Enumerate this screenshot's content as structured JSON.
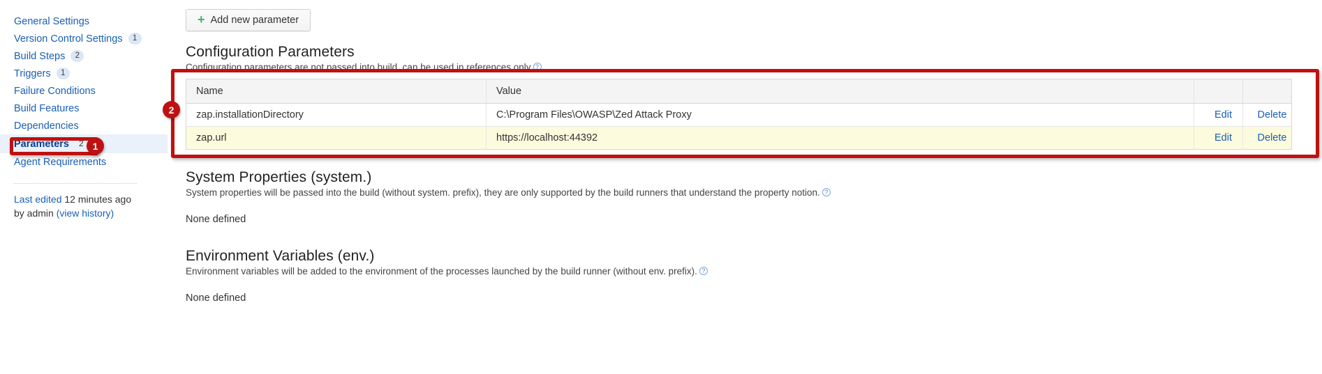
{
  "sidebar": {
    "items": [
      {
        "label": "General Settings",
        "badge": "",
        "selected": false
      },
      {
        "label": "Version Control Settings",
        "badge": "1",
        "selected": false
      },
      {
        "label": "Build Steps",
        "badge": "2",
        "selected": false
      },
      {
        "label": "Triggers",
        "badge": "1",
        "selected": false
      },
      {
        "label": "Failure Conditions",
        "badge": "",
        "selected": false
      },
      {
        "label": "Build Features",
        "badge": "",
        "selected": false
      },
      {
        "label": "Dependencies",
        "badge": "",
        "selected": false
      },
      {
        "label": "Parameters",
        "badge": "2",
        "selected": true
      },
      {
        "label": "Agent Requirements",
        "badge": "",
        "selected": false
      }
    ],
    "last_edited": {
      "link_label": "Last edited",
      "time": "12 minutes ago",
      "by": "by admin",
      "history_label": "(view history)"
    }
  },
  "toolbar": {
    "add_parameter_label": "Add new parameter",
    "plus_icon": "plus-icon"
  },
  "sections": [
    {
      "title": "Configuration Parameters",
      "description": "Configuration parameters are not passed into build, can be used in references only",
      "help_icon": "help-icon"
    },
    {
      "title": "System Properties (system.)",
      "description": "System properties will be passed into the build (without system. prefix), they are only supported by the build runners that understand the property notion.",
      "help_icon": "help-icon",
      "empty_text": "None defined"
    },
    {
      "title": "Environment Variables (env.)",
      "description": "Environment variables will be added to the environment of the processes launched by the build runner (without env. prefix).",
      "help_icon": "help-icon",
      "empty_text": "None defined"
    }
  ],
  "table": {
    "headers": [
      "Name",
      "Value"
    ],
    "actions": {
      "edit": "Edit",
      "delete": "Delete"
    },
    "rows": [
      {
        "name": "zap.installationDirectory",
        "value": "C:\\Program Files\\OWASP\\Zed Attack Proxy"
      },
      {
        "name": "zap.url",
        "value": "https://localhost:44392"
      }
    ]
  },
  "annotations": {
    "steps": [
      {
        "number": "1",
        "target": "parameters-sidebar-item"
      },
      {
        "number": "2",
        "target": "configuration-parameters-table"
      }
    ],
    "color": "#bf1111"
  }
}
